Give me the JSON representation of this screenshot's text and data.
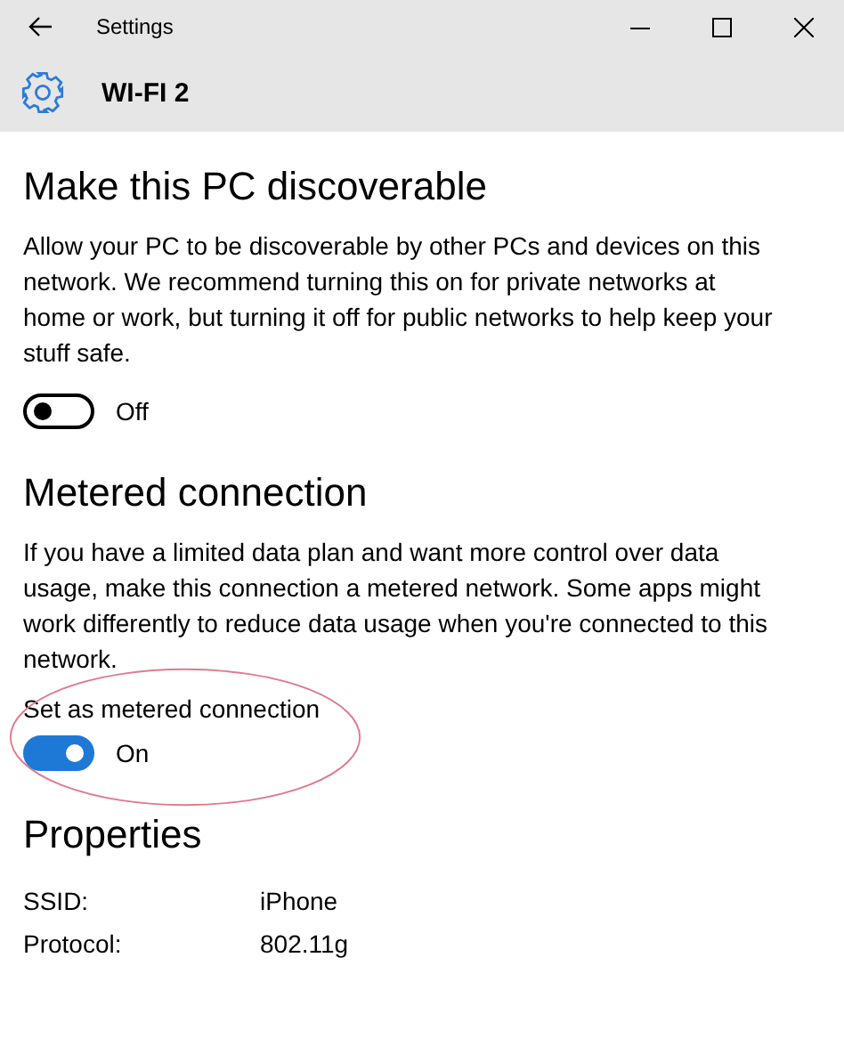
{
  "window": {
    "title": "Settings"
  },
  "header": {
    "title": "WI-FI 2"
  },
  "sections": [
    {
      "heading": "Make this PC discoverable",
      "description": "Allow your PC to be discoverable by other PCs and devices on this network. We recommend turning this on for private networks at home or work, but turning it off for public networks to help keep your stuff safe.",
      "toggle": {
        "on": false,
        "state_label": "Off"
      }
    },
    {
      "heading": "Metered connection",
      "description": "If you have a limited data plan and want more control over data usage, make this connection a metered network. Some apps might work differently to reduce data usage when you're connected to this network.",
      "toggle": {
        "label": "Set as metered connection",
        "on": true,
        "state_label": "On",
        "annotated": true
      }
    }
  ],
  "properties": {
    "heading": "Properties",
    "rows": [
      {
        "label": "SSID:",
        "value": "iPhone"
      },
      {
        "label": "Protocol:",
        "value": "802.11g"
      }
    ]
  }
}
